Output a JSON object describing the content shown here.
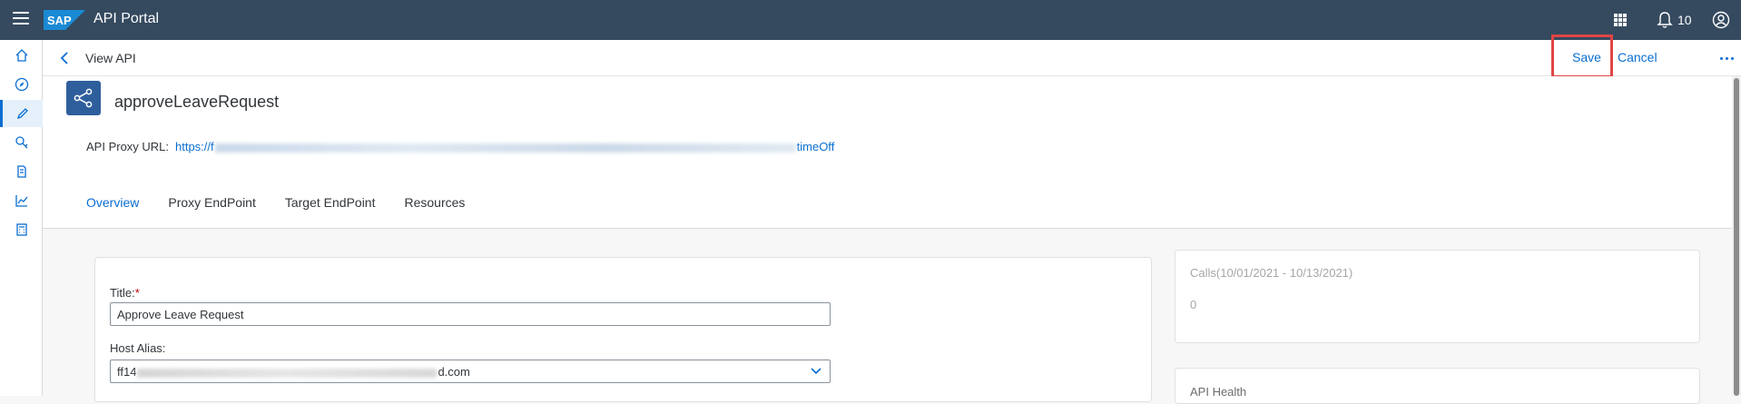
{
  "shell": {
    "logo": "SAP",
    "app_title": "API Portal",
    "notification_count": "10"
  },
  "sidebar": {
    "items": [
      {
        "icon": "home-icon"
      },
      {
        "icon": "compass-icon"
      },
      {
        "icon": "pencil-icon"
      },
      {
        "icon": "search-keys-icon"
      },
      {
        "icon": "document-icon"
      },
      {
        "icon": "analytics-icon"
      },
      {
        "icon": "calculator-icon"
      }
    ]
  },
  "header": {
    "title": "View API",
    "save": "Save",
    "cancel": "Cancel"
  },
  "api": {
    "name": "approveLeaveRequest",
    "proxy_url_label": "API Proxy URL:",
    "proxy_url_start": "https://f",
    "proxy_url_end": "timeOff"
  },
  "tabs": [
    "Overview",
    "Proxy EndPoint",
    "Target EndPoint",
    "Resources"
  ],
  "form": {
    "title_label": "Title:",
    "title_required": "*",
    "title_value": "Approve Leave Request",
    "host_alias_label": "Host Alias:",
    "host_alias_start": "ff14",
    "host_alias_end": "d.com"
  },
  "calls": {
    "title": "Calls(10/01/2021 - 10/13/2021)",
    "value": "0"
  },
  "health": {
    "title": "API Health"
  },
  "colors": {
    "shell": "#354a5f",
    "accent": "#0a6ed1",
    "highlight": "#e04545"
  }
}
